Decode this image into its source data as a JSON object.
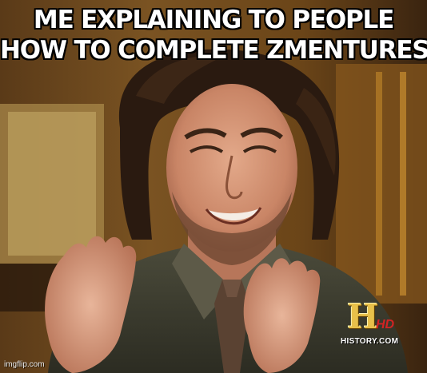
{
  "meme": {
    "caption_line1": "ME EXPLAINING TO PEOPLE",
    "caption_line2": "HOW TO COMPLETE ZMENTURES",
    "channel_logo_letter": "H",
    "channel_logo_suffix": "HD",
    "channel_url": "HISTORY.COM",
    "watermark": "imgflip.com"
  }
}
